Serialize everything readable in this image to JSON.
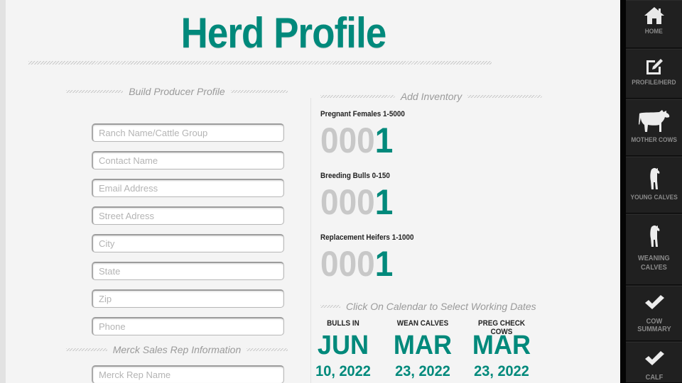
{
  "page": {
    "title": "Herd Profile"
  },
  "producer_profile": {
    "heading": "Build Producer Profile",
    "fields": [
      {
        "name": "ranch-name-field",
        "placeholder": "Ranch Name/Cattle Group",
        "value": ""
      },
      {
        "name": "contact-name-field",
        "placeholder": "Contact Name",
        "value": ""
      },
      {
        "name": "email-address-field",
        "placeholder": "Email Address",
        "value": ""
      },
      {
        "name": "street-address-field",
        "placeholder": "Street Adress",
        "value": ""
      },
      {
        "name": "city-field",
        "placeholder": "City",
        "value": ""
      },
      {
        "name": "state-field",
        "placeholder": "State",
        "value": ""
      },
      {
        "name": "zip-field",
        "placeholder": "Zip",
        "value": ""
      },
      {
        "name": "phone-field",
        "placeholder": "Phone",
        "value": ""
      }
    ]
  },
  "sales_rep": {
    "heading": "Merck Sales Rep Information",
    "fields": [
      {
        "name": "merck-rep-name-field",
        "placeholder": "Merck Rep Name",
        "value": ""
      }
    ]
  },
  "inventory": {
    "heading": "Add Inventory",
    "items": [
      {
        "label": "Pregnant Females 1-5000",
        "leading_zeros": "000",
        "value": "1"
      },
      {
        "label": "Breeding Bulls 0-150",
        "leading_zeros": "000",
        "value": "1"
      },
      {
        "label": "Replacement Heifers 1-1000",
        "leading_zeros": "000",
        "value": "1"
      }
    ]
  },
  "working_dates": {
    "heading": "Click On Calendar to Select Working Dates",
    "dates": [
      {
        "label": "BULLS IN",
        "month": "JUN",
        "day_year": "10, 2022"
      },
      {
        "label": "WEAN CALVES",
        "month": "MAR",
        "day_year": "23, 2022"
      },
      {
        "label": "PREG CHECK COWS",
        "month": "MAR",
        "day_year": "23, 2022"
      }
    ]
  },
  "sidebar": {
    "items": [
      {
        "label": "HOME",
        "icon": "home-icon"
      },
      {
        "label": "PROFILE/HERD",
        "icon": "edit-icon"
      },
      {
        "label": "MOTHER COWS",
        "icon": "cow-icon"
      },
      {
        "label": "YOUNG CALVES",
        "icon": "calf-icon"
      },
      {
        "label": "WEANING\nCALVES",
        "icon": "calf-icon"
      },
      {
        "label": "COW\nSUMMARY",
        "icon": "checkmark-icon"
      },
      {
        "label": "CALF",
        "icon": "checkmark-icon"
      }
    ]
  },
  "colors": {
    "accent": "#00897b",
    "counter_lead": "#c8c8c8",
    "sidebar_bg": "#1a1a1a"
  }
}
